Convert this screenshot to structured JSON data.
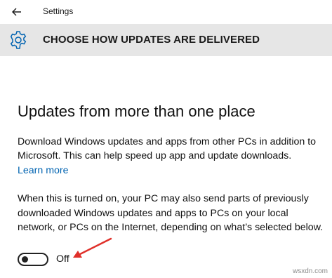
{
  "window": {
    "title": "Settings"
  },
  "header": {
    "title": "CHOOSE HOW UPDATES ARE DELIVERED"
  },
  "main": {
    "heading": "Updates from more than one place",
    "description": "Download Windows updates and apps from other PCs in addition to Microsoft. This can help speed up app and update downloads.",
    "learn_more": "Learn more",
    "note": "When this is turned on, your PC may also send parts of previously downloaded Windows updates and apps to PCs on your local network, or PCs on the Internet, depending on what’s selected below.",
    "toggle": {
      "state_label": "Off",
      "on": false
    }
  },
  "watermark": "wsxdn.com",
  "colors": {
    "accent": "#0063b1",
    "header_bg": "#e6e6e6",
    "annotation_arrow": "#e0302a"
  }
}
